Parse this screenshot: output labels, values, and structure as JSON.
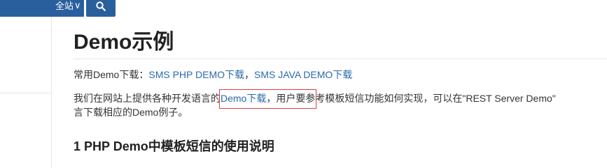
{
  "header": {
    "scope_label": "全站",
    "scope_chevron": "∨",
    "search_icon": "search-icon",
    "accent_color": "#2a5f9e"
  },
  "main": {
    "title": "Demo示例",
    "downloads": {
      "prefix": "常用Demo下载：",
      "php_link": "SMS PHP DEMO下载",
      "separator": "，",
      "java_link": "SMS JAVA DEMO下载"
    },
    "description": {
      "part1": "我们在网站上提供各种开发语言的",
      "link": "Demo下载",
      "part2": "，用户要参考模板短信功能如何实现，可以在\"REST Server Demo\"",
      "line2": "言下载相应的Demo例子。"
    },
    "section1_heading": "1 PHP Demo中模板短信的使用说明"
  },
  "colors": {
    "link": "#2a6aae",
    "highlight": "#d94040"
  }
}
